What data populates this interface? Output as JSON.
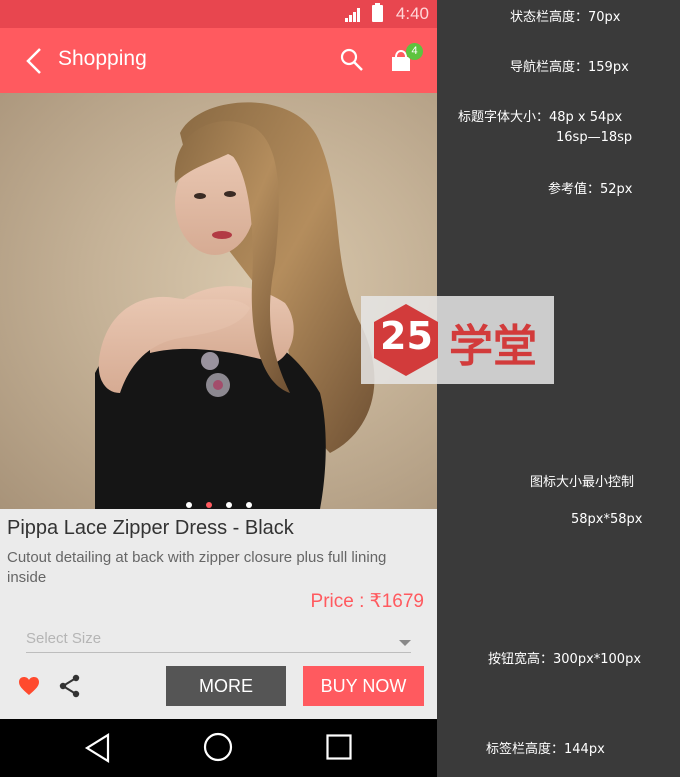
{
  "status_bar": {
    "time": "4:40"
  },
  "nav": {
    "title": "Shopping",
    "cart_count": "4"
  },
  "carousel": {
    "dots": 4,
    "active_index": 1
  },
  "product": {
    "name": "Pippa Lace Zipper Dress - Black",
    "description": "Cutout detailing at back with zipper closure plus full lining inside",
    "price": "Price : ₹1679",
    "size_placeholder": "Select Size",
    "more_label": "MORE",
    "buy_label": "BUY NOW"
  },
  "colors": {
    "accent": "#ff5a5f",
    "status": "#e8464f",
    "badge": "#5ec33f",
    "dark_button": "#555555"
  },
  "annotations": {
    "status_bar_height": "状态栏高度：70px",
    "nav_bar_height": "导航栏高度：159px",
    "title_font_size": "标题字体大小：48p x 54px",
    "title_sp": "16sp—18sp",
    "reference_value": "参考值：52px",
    "icon_min_size": "图标大小最小控制",
    "icon_size": "58px*58px",
    "button_size": "按钮宽高：300px*100px",
    "tab_bar_height": "标签栏高度：144px"
  },
  "watermark": {
    "number": "25",
    "text": "学堂"
  },
  "icons": [
    "signal-icon",
    "battery-icon",
    "back-icon",
    "search-icon",
    "shopping-bag-icon",
    "heart-icon",
    "share-icon",
    "nav-back-icon",
    "nav-home-icon",
    "nav-recent-icon"
  ]
}
